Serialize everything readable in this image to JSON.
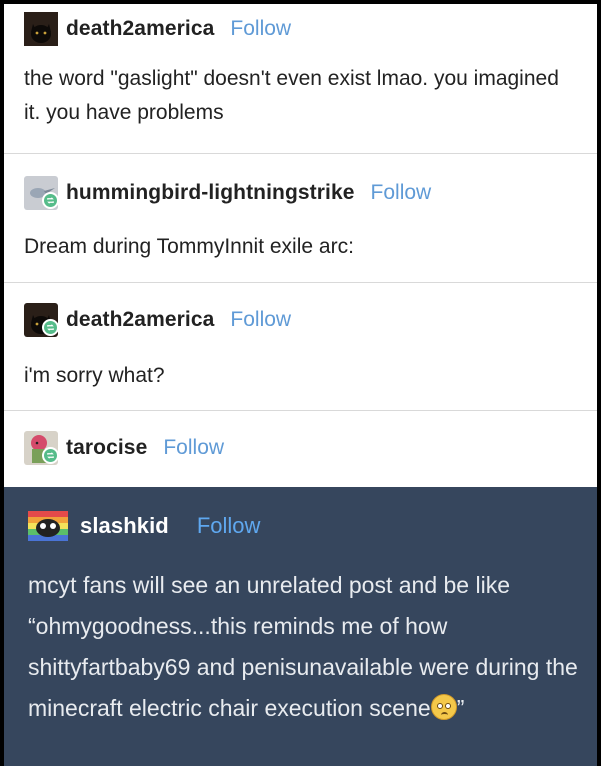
{
  "posts": [
    {
      "username": "death2america",
      "follow": "Follow",
      "text": "the word \"gaslight\" doesn't even exist lmao. you imagined it. you have problems",
      "reblog": false
    },
    {
      "username": "hummingbird-lightningstrike",
      "follow": "Follow",
      "text": "Dream during TommyInnit exile arc:",
      "reblog": true
    },
    {
      "username": "death2america",
      "follow": "Follow",
      "text": "i'm sorry what?",
      "reblog": true
    },
    {
      "username": "tarocise",
      "follow": "Follow",
      "text": "",
      "reblog": true
    },
    {
      "username": "slashkid",
      "follow": "Follow",
      "text": "mcyt fans will see an unrelated post and be like “ohmygoodness...this reminds me of how shittyfartbaby69 and penisunavailable  were during the minecraft electric chair execution scene",
      "text_end": "”",
      "emoji": "pleading-face-emoji",
      "reblog": false
    }
  ],
  "colors": {
    "follow_light": "#5f9ad6",
    "follow_dark": "#5fa8f0",
    "dark_bg": "#36465d",
    "reblog_badge": "#56bc8a"
  }
}
